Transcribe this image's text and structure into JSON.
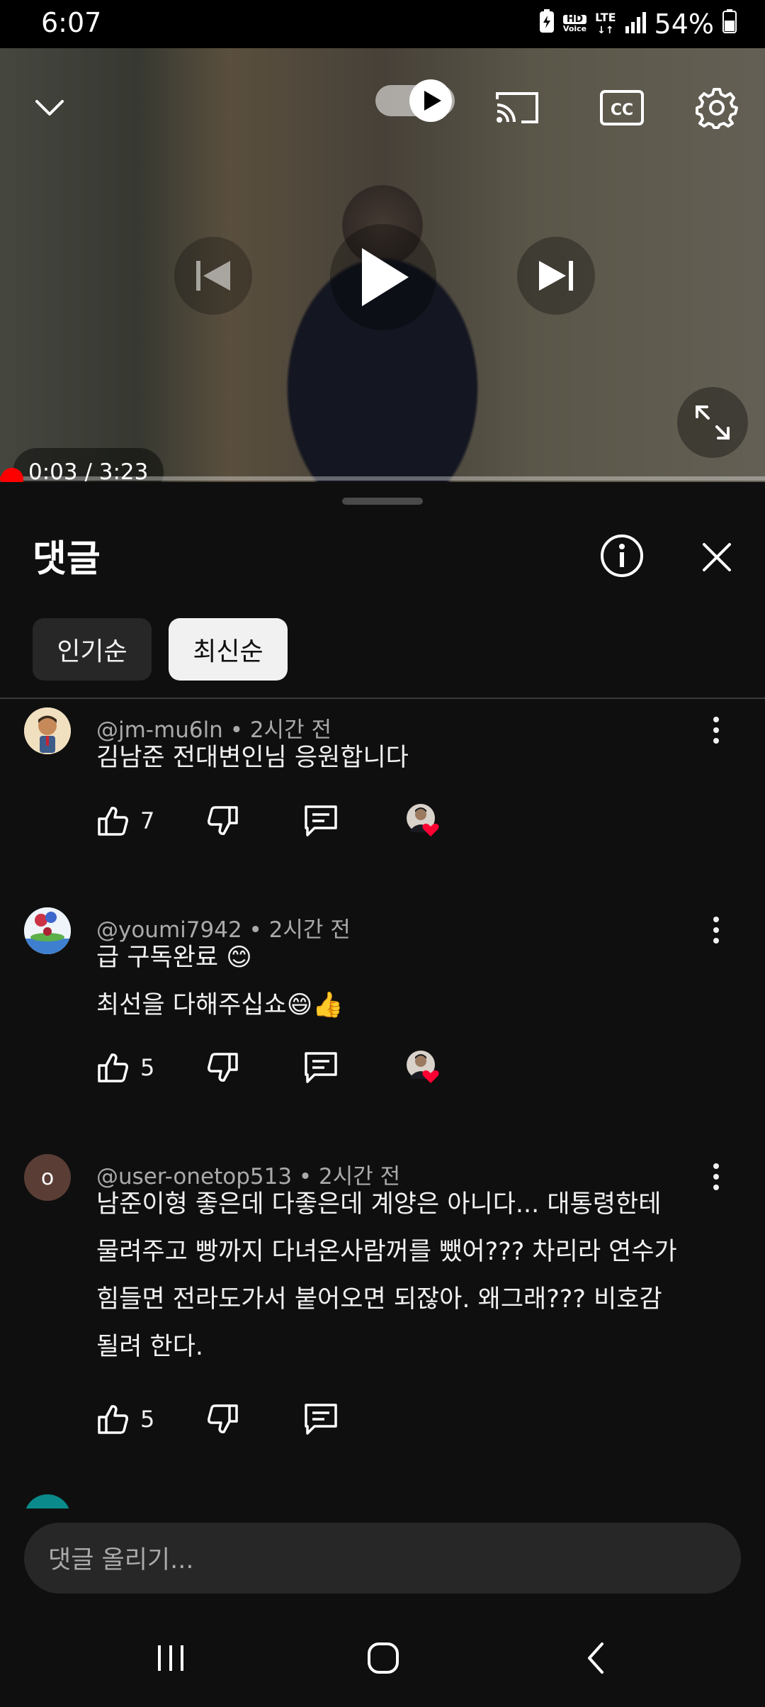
{
  "status_bar": {
    "time": "6:07",
    "hd_label": "HD",
    "voice_label": "Voice",
    "network": "LTE",
    "battery": "54%"
  },
  "player": {
    "time_display": "0:03 / 3:23",
    "progress_fraction": 0.0155,
    "autoplay_on": true
  },
  "comments_panel": {
    "title": "댓글",
    "sort_chips": [
      {
        "label": "인기순",
        "selected": false
      },
      {
        "label": "최신순",
        "selected": true
      }
    ]
  },
  "comments": [
    {
      "author": "@jm-mu6ln",
      "time": "• 2시간 전",
      "lines": [
        "김남준 전대변인님 응원합니다"
      ],
      "likes": "7",
      "creator_heart": true
    },
    {
      "author": "@youmi7942",
      "time": "• 2시간 전",
      "lines": [
        "급 구독완료 😊",
        "최선을  다해주십쇼😄👍"
      ],
      "likes": "5",
      "creator_heart": true
    },
    {
      "author": "@user-onetop513",
      "avatar_letter": "o",
      "time": "• 2시간 전",
      "lines": [
        "남준이형 좋은데 다좋은데 계양은 아니다... 대통령한테",
        "물려주고 빵까지 다녀온사람꺼를 뺐어??? 차리라 연수가",
        "힘들면 전라도가서 붙어오면 되잖아. 왜그래??? 비호감",
        "될려 한다."
      ],
      "likes": "5",
      "creator_heart": false
    }
  ],
  "composer": {
    "placeholder": "댓글 올리기..."
  },
  "colors": {
    "background": "#0f0f0f",
    "chip_selected": "#f1f1f1",
    "progress": "#ff0000",
    "heart": "#ff0033"
  }
}
